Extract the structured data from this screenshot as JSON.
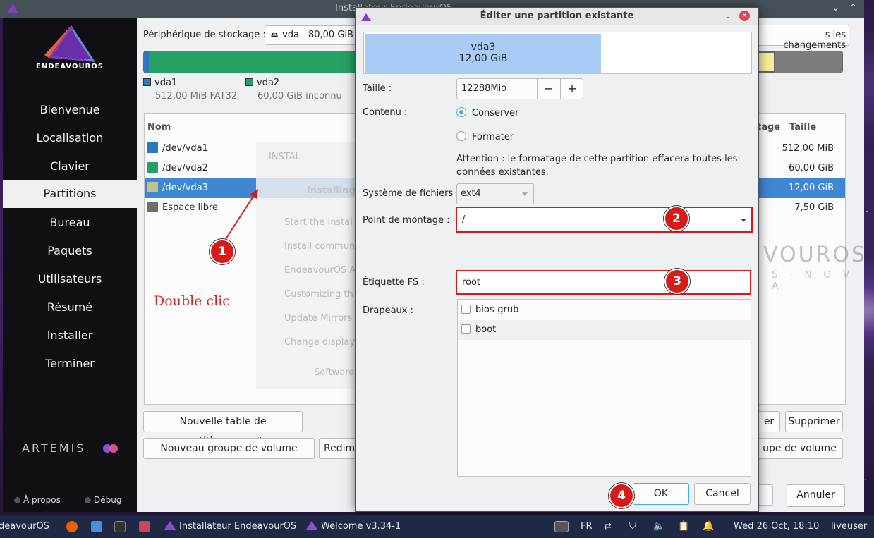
{
  "window": {
    "title": "Installateur EndeavourOS"
  },
  "sidebar": {
    "logo_text": "ENDEAVOUROS",
    "items": [
      {
        "label": "Bienvenue"
      },
      {
        "label": "Localisation"
      },
      {
        "label": "Clavier"
      },
      {
        "label": "Partitions"
      },
      {
        "label": "Bureau"
      },
      {
        "label": "Paquets"
      },
      {
        "label": "Utilisateurs"
      },
      {
        "label": "Résumé"
      },
      {
        "label": "Installer"
      },
      {
        "label": "Terminer"
      }
    ],
    "active_index": 3,
    "brand": "ARTEMIS",
    "about": "À propos",
    "debug": "Débug"
  },
  "partitions_page": {
    "device_label": "Périphérique de stockage :",
    "device_value": "vda - 80,00 GiB (",
    "revert_label": "s les changements",
    "legend": [
      {
        "name": "vda1",
        "detail": "512,00 MiB  FAT32",
        "color": "#2a79c0"
      },
      {
        "name": "vda2",
        "detail": "60,00 GiB  inconnu",
        "color": "#27a163"
      }
    ],
    "columns": {
      "name": "Nom",
      "type_partial": "tage",
      "size": "Taille"
    },
    "rows": [
      {
        "name": "/dev/vda1",
        "size": "512,00 MiB",
        "color": "#2a79c0"
      },
      {
        "name": "/dev/vda2",
        "size": "60,00 GiB",
        "color": "#27a163"
      },
      {
        "name": "/dev/vda3",
        "size": "12,00 GiB",
        "color": "#c0c48a"
      },
      {
        "name": "Espace libre",
        "size": "7,50 GiB",
        "color": "#6d6d6d"
      }
    ],
    "selected_row": 2,
    "ghost_lines": [
      "INSTAL",
      "Installing",
      "Start the Instal",
      "Install commun",
      "EndeavourOS A",
      "Customizing th",
      "Update Mirrors",
      "Change display",
      "Software"
    ],
    "watermark": "VOUROS",
    "watermark_sub": "S · N O V A",
    "buttons": {
      "new_table": "Nouvelle table de partitionnement",
      "new_vg": "Nouveau groupe de volume",
      "resize_partial": "Redime",
      "edit_partial": "er",
      "delete": "Supprimer",
      "vg_partial": "upe de volume",
      "cancel": "Annuler"
    },
    "annotation": "Double clic"
  },
  "dialog": {
    "title": "Éditer une partition existante",
    "partition_name": "vda3",
    "partition_size": "12,00 GiB",
    "size_label": "Taille :",
    "size_value": "12288Mio",
    "minus": "−",
    "plus": "+",
    "content_label": "Contenu :",
    "keep_label": "Conserver",
    "format_label": "Formater",
    "warning": "Attention : le formatage de cette partition effacera toutes les données existantes.",
    "fs_label": "Système de fichiers :",
    "fs_value": "ext4",
    "mount_label": "Point de montage :",
    "mount_value": "/",
    "fslabel_label": "Étiquette FS :",
    "fslabel_value": "root",
    "flags_label": "Drapeaux :",
    "flags": [
      {
        "label": "bios-grub",
        "checked": false
      },
      {
        "label": "boot",
        "checked": false
      }
    ],
    "ok": "OK",
    "cancel": "Cancel"
  },
  "markers": [
    "1",
    "2",
    "3",
    "4"
  ],
  "taskbar": {
    "start_partial": "deavourOS",
    "app1": "Installateur EndeavourOS",
    "app2": "Welcome v3.34-1",
    "lang": "FR",
    "clock": "Wed 26 Oct, 18:10",
    "user": "liveuser"
  }
}
